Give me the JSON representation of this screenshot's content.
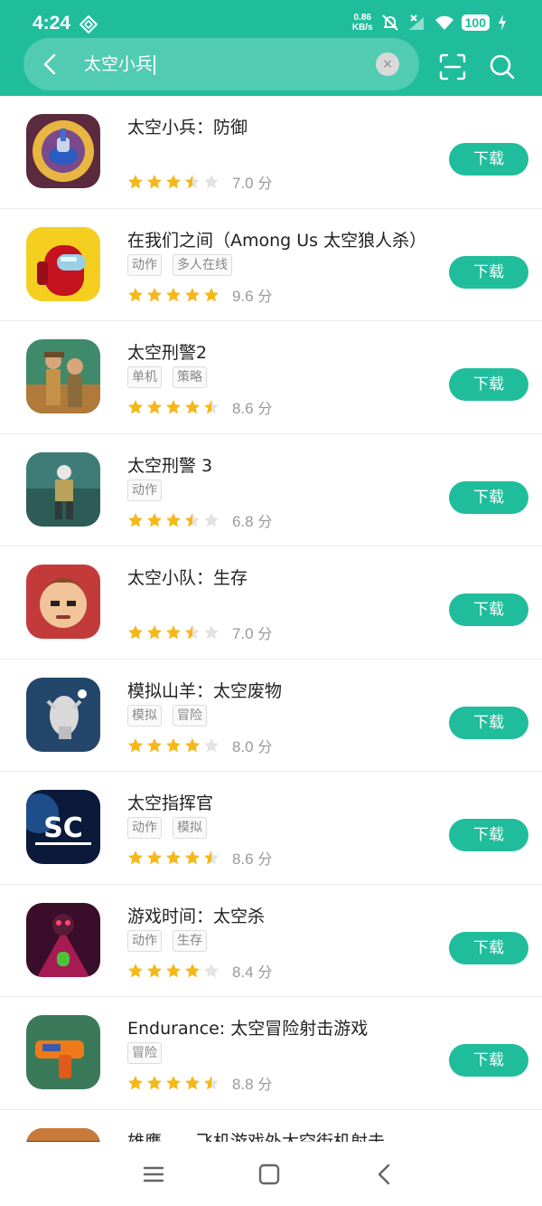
{
  "status": {
    "time": "4:24",
    "speed_value": "0.86",
    "speed_unit": "KB/s",
    "battery": "100"
  },
  "search": {
    "query": "太空小兵",
    "clear_symbol": "×"
  },
  "apps": [
    {
      "title": "太空小兵：防御",
      "tags": [],
      "rating": 3.5,
      "score": "7.0",
      "score_unit": "分",
      "button": "下载"
    },
    {
      "title": "在我们之间（Among Us 太空狼人杀）",
      "tags": [
        "动作",
        "多人在线"
      ],
      "rating": 5,
      "score": "9.6",
      "score_unit": "分",
      "button": "下载"
    },
    {
      "title": "太空刑警2",
      "tags": [
        "单机",
        "策略"
      ],
      "rating": 4.5,
      "score": "8.6",
      "score_unit": "分",
      "button": "下载"
    },
    {
      "title": "太空刑警 3",
      "tags": [
        "动作"
      ],
      "rating": 3.5,
      "score": "6.8",
      "score_unit": "分",
      "button": "下载"
    },
    {
      "title": "太空小队：生存",
      "tags": [],
      "rating": 3.5,
      "score": "7.0",
      "score_unit": "分",
      "button": "下载"
    },
    {
      "title": "模拟山羊：太空废物",
      "tags": [
        "模拟",
        "冒险"
      ],
      "rating": 4,
      "score": "8.0",
      "score_unit": "分",
      "button": "下载"
    },
    {
      "title": "太空指挥官",
      "tags": [
        "动作",
        "模拟"
      ],
      "rating": 4.5,
      "score": "8.6",
      "score_unit": "分",
      "button": "下载"
    },
    {
      "title": "游戏时间：太空杀",
      "tags": [
        "动作",
        "生存"
      ],
      "rating": 4,
      "score": "8.4",
      "score_unit": "分",
      "button": "下载"
    },
    {
      "title": "Endurance: 太空冒险射击游戏",
      "tags": [
        "冒险"
      ],
      "rating": 4.5,
      "score": "8.8",
      "score_unit": "分",
      "button": "下载"
    },
    {
      "title": "雄鹰——飞机游戏外太空街机射击",
      "tags": [],
      "rating": 0,
      "score": "",
      "score_unit": "",
      "button": ""
    }
  ],
  "icons": [
    "back-icon",
    "clear-icon",
    "scan-icon",
    "search-icon",
    "menu-icon",
    "home-icon",
    "nav-back-icon"
  ],
  "colors": {
    "accent": "#20bd9c",
    "star": "#f5b81b",
    "star_empty": "#e3e3e3"
  }
}
